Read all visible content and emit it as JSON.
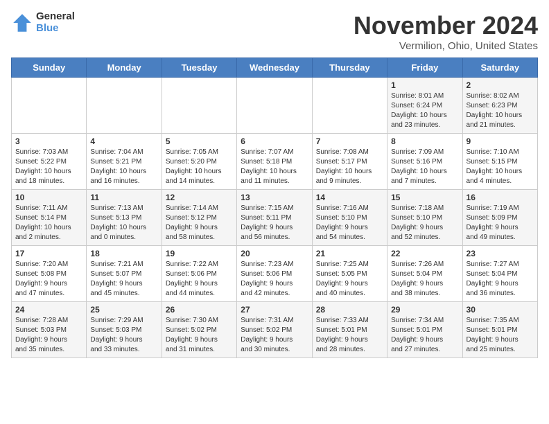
{
  "header": {
    "logo_general": "General",
    "logo_blue": "Blue",
    "month_title": "November 2024",
    "location": "Vermilion, Ohio, United States"
  },
  "days_of_week": [
    "Sunday",
    "Monday",
    "Tuesday",
    "Wednesday",
    "Thursday",
    "Friday",
    "Saturday"
  ],
  "weeks": [
    [
      {
        "day": "",
        "info": ""
      },
      {
        "day": "",
        "info": ""
      },
      {
        "day": "",
        "info": ""
      },
      {
        "day": "",
        "info": ""
      },
      {
        "day": "",
        "info": ""
      },
      {
        "day": "1",
        "info": "Sunrise: 8:01 AM\nSunset: 6:24 PM\nDaylight: 10 hours\nand 23 minutes."
      },
      {
        "day": "2",
        "info": "Sunrise: 8:02 AM\nSunset: 6:23 PM\nDaylight: 10 hours\nand 21 minutes."
      }
    ],
    [
      {
        "day": "3",
        "info": "Sunrise: 7:03 AM\nSunset: 5:22 PM\nDaylight: 10 hours\nand 18 minutes."
      },
      {
        "day": "4",
        "info": "Sunrise: 7:04 AM\nSunset: 5:21 PM\nDaylight: 10 hours\nand 16 minutes."
      },
      {
        "day": "5",
        "info": "Sunrise: 7:05 AM\nSunset: 5:20 PM\nDaylight: 10 hours\nand 14 minutes."
      },
      {
        "day": "6",
        "info": "Sunrise: 7:07 AM\nSunset: 5:18 PM\nDaylight: 10 hours\nand 11 minutes."
      },
      {
        "day": "7",
        "info": "Sunrise: 7:08 AM\nSunset: 5:17 PM\nDaylight: 10 hours\nand 9 minutes."
      },
      {
        "day": "8",
        "info": "Sunrise: 7:09 AM\nSunset: 5:16 PM\nDaylight: 10 hours\nand 7 minutes."
      },
      {
        "day": "9",
        "info": "Sunrise: 7:10 AM\nSunset: 5:15 PM\nDaylight: 10 hours\nand 4 minutes."
      }
    ],
    [
      {
        "day": "10",
        "info": "Sunrise: 7:11 AM\nSunset: 5:14 PM\nDaylight: 10 hours\nand 2 minutes."
      },
      {
        "day": "11",
        "info": "Sunrise: 7:13 AM\nSunset: 5:13 PM\nDaylight: 10 hours\nand 0 minutes."
      },
      {
        "day": "12",
        "info": "Sunrise: 7:14 AM\nSunset: 5:12 PM\nDaylight: 9 hours\nand 58 minutes."
      },
      {
        "day": "13",
        "info": "Sunrise: 7:15 AM\nSunset: 5:11 PM\nDaylight: 9 hours\nand 56 minutes."
      },
      {
        "day": "14",
        "info": "Sunrise: 7:16 AM\nSunset: 5:10 PM\nDaylight: 9 hours\nand 54 minutes."
      },
      {
        "day": "15",
        "info": "Sunrise: 7:18 AM\nSunset: 5:10 PM\nDaylight: 9 hours\nand 52 minutes."
      },
      {
        "day": "16",
        "info": "Sunrise: 7:19 AM\nSunset: 5:09 PM\nDaylight: 9 hours\nand 49 minutes."
      }
    ],
    [
      {
        "day": "17",
        "info": "Sunrise: 7:20 AM\nSunset: 5:08 PM\nDaylight: 9 hours\nand 47 minutes."
      },
      {
        "day": "18",
        "info": "Sunrise: 7:21 AM\nSunset: 5:07 PM\nDaylight: 9 hours\nand 45 minutes."
      },
      {
        "day": "19",
        "info": "Sunrise: 7:22 AM\nSunset: 5:06 PM\nDaylight: 9 hours\nand 44 minutes."
      },
      {
        "day": "20",
        "info": "Sunrise: 7:23 AM\nSunset: 5:06 PM\nDaylight: 9 hours\nand 42 minutes."
      },
      {
        "day": "21",
        "info": "Sunrise: 7:25 AM\nSunset: 5:05 PM\nDaylight: 9 hours\nand 40 minutes."
      },
      {
        "day": "22",
        "info": "Sunrise: 7:26 AM\nSunset: 5:04 PM\nDaylight: 9 hours\nand 38 minutes."
      },
      {
        "day": "23",
        "info": "Sunrise: 7:27 AM\nSunset: 5:04 PM\nDaylight: 9 hours\nand 36 minutes."
      }
    ],
    [
      {
        "day": "24",
        "info": "Sunrise: 7:28 AM\nSunset: 5:03 PM\nDaylight: 9 hours\nand 35 minutes."
      },
      {
        "day": "25",
        "info": "Sunrise: 7:29 AM\nSunset: 5:03 PM\nDaylight: 9 hours\nand 33 minutes."
      },
      {
        "day": "26",
        "info": "Sunrise: 7:30 AM\nSunset: 5:02 PM\nDaylight: 9 hours\nand 31 minutes."
      },
      {
        "day": "27",
        "info": "Sunrise: 7:31 AM\nSunset: 5:02 PM\nDaylight: 9 hours\nand 30 minutes."
      },
      {
        "day": "28",
        "info": "Sunrise: 7:33 AM\nSunset: 5:01 PM\nDaylight: 9 hours\nand 28 minutes."
      },
      {
        "day": "29",
        "info": "Sunrise: 7:34 AM\nSunset: 5:01 PM\nDaylight: 9 hours\nand 27 minutes."
      },
      {
        "day": "30",
        "info": "Sunrise: 7:35 AM\nSunset: 5:01 PM\nDaylight: 9 hours\nand 25 minutes."
      }
    ]
  ]
}
